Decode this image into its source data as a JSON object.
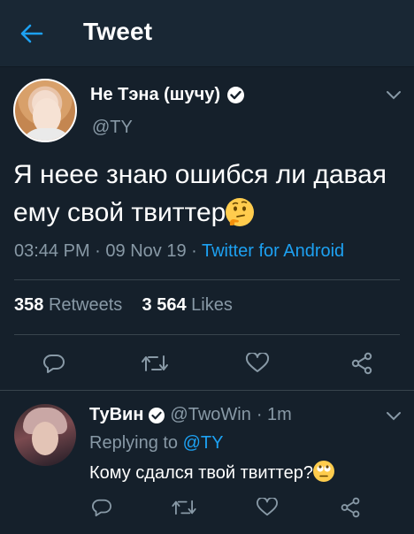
{
  "header": {
    "title": "Tweet"
  },
  "tweet": {
    "author_name": "Не Тэна (шучу)",
    "author_handle": "@TY",
    "text": "Я неее знаю ошибся ли давая ему свой твиттер",
    "emoji": "thinking-face",
    "time": "03:44 PM",
    "separator": " · ",
    "date": "09 Nov 19",
    "source": "Twitter for Android",
    "retweets_count": "358",
    "retweets_label": "Retweets",
    "likes_count": "3 564",
    "likes_label": "Likes"
  },
  "reply": {
    "author_name": "ТуВин",
    "author_handle": "@TwoWin",
    "age": "· 1m",
    "replying_prefix": "Replying to",
    "replying_to": "@TY",
    "text": "Кому сдался твой твиттер?",
    "emoji": "face-with-rolling-eyes"
  },
  "icons": {
    "back": "arrow-left-icon",
    "verified": "verified-badge-icon",
    "caret": "chevron-down-icon",
    "reply": "reply-bubble-icon",
    "retweet": "retweet-icon",
    "like": "heart-icon",
    "share": "share-icon"
  },
  "colors": {
    "background": "#15202b",
    "header": "#192734",
    "accent": "#1da1f2",
    "secondary_text": "#8899a6",
    "divider": "#38444d"
  }
}
